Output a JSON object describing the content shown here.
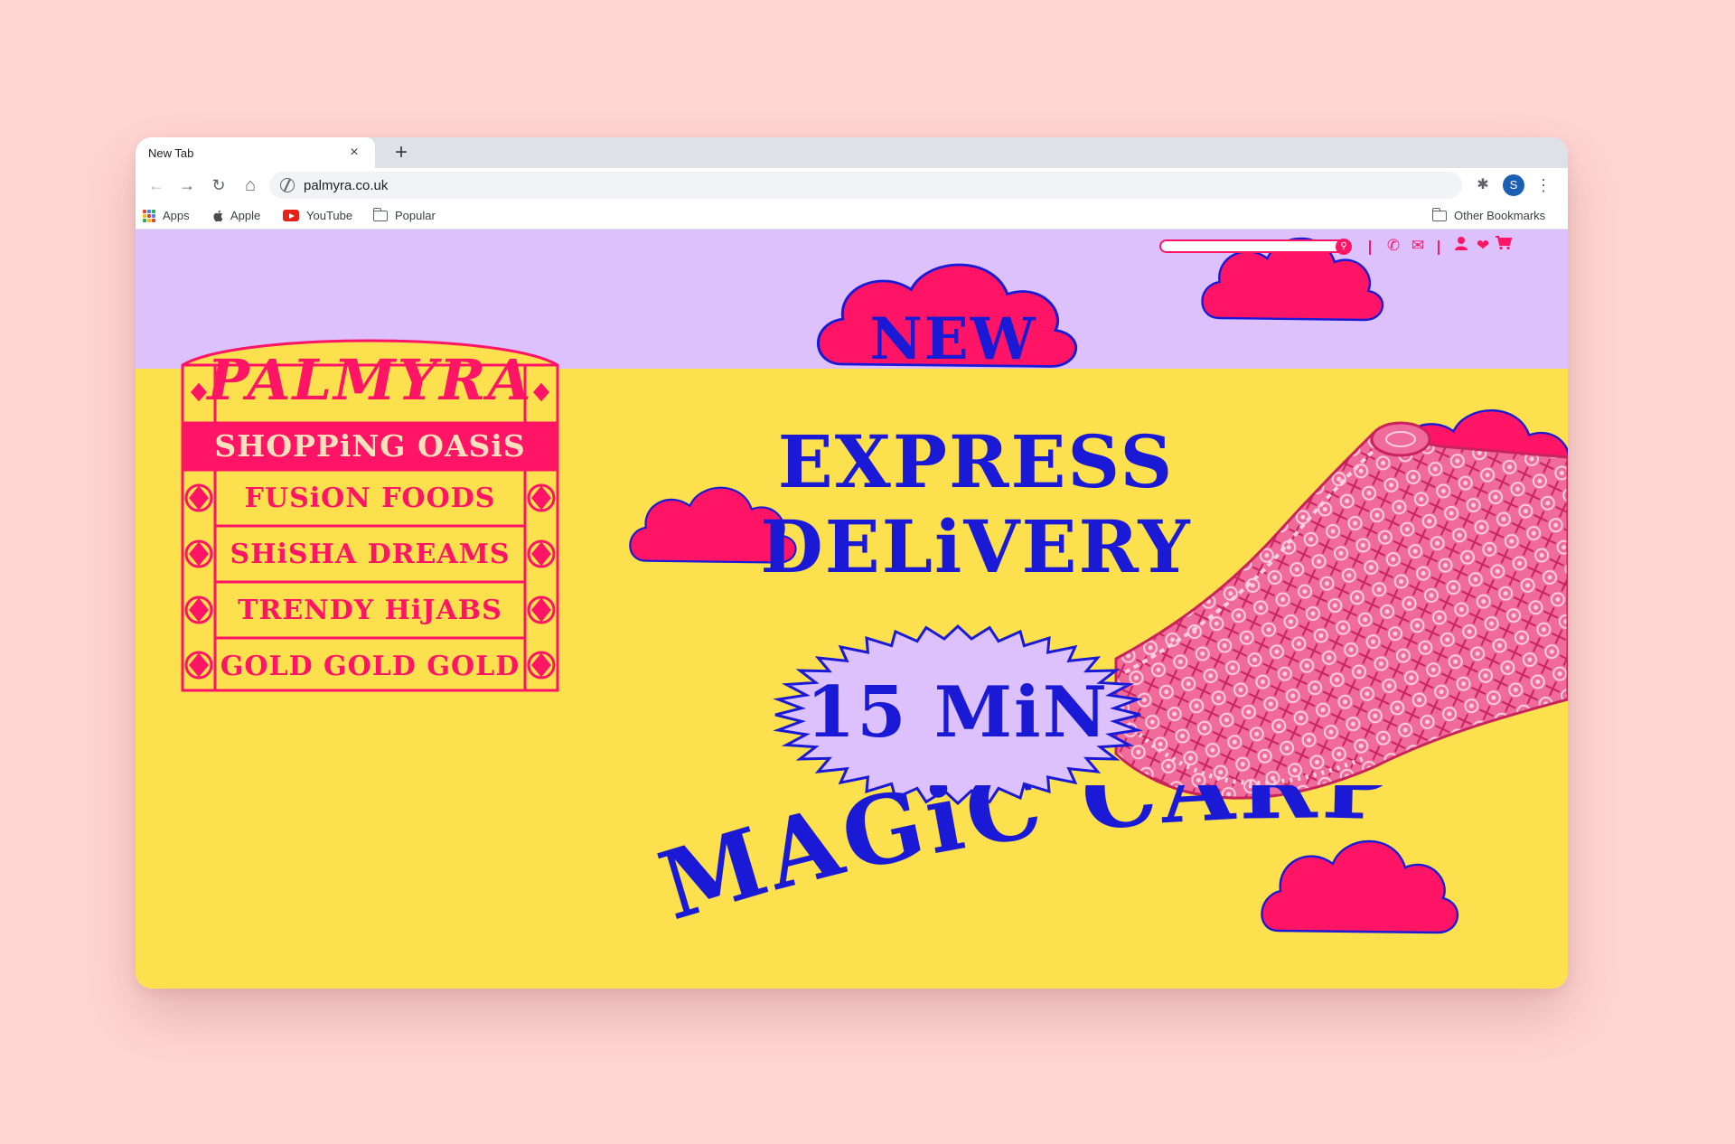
{
  "browser": {
    "tab_title": "New Tab",
    "tab_close": "×",
    "new_tab": "+",
    "url": "palmyra.co.uk",
    "profile_initial": "S",
    "back": "←",
    "forward": "→",
    "reload": "↻",
    "home": "⌂",
    "extensions": "✱",
    "menu": "⋮"
  },
  "bookmarks": {
    "items": [
      {
        "label": "Apps",
        "icon": "apps-grid-icon"
      },
      {
        "label": "Apple",
        "icon": "apple-icon"
      },
      {
        "label": "YouTube",
        "icon": "youtube-icon"
      },
      {
        "label": "Popular",
        "icon": "folder-icon"
      }
    ],
    "other": "Other Bookmarks"
  },
  "site": {
    "header_icons": [
      "search-icon",
      "phone-icon",
      "mail-icon",
      "user-icon",
      "heart-icon",
      "cart-icon"
    ],
    "board": {
      "brand": "PALMYRA",
      "tagline": "SHOPPiNG OASiS",
      "items": [
        "FUSiON FOODS",
        "SHiSHA DREAMS",
        "TRENDY HiJABS",
        "GOLD GOLD GOLD"
      ]
    },
    "hero": {
      "badge_top": "NEW",
      "line1": "EXPRESS",
      "line2": "DELiVERY",
      "time": "15 MiN",
      "tagline": "MAGiC CARPET"
    }
  },
  "colors": {
    "page_background": "#ffd6d4",
    "sky": "#dcc1fd",
    "ground": "#fce04e",
    "pink": "#ff1466",
    "blue": "#1a1ad6",
    "lilac": "#dcc1fd"
  }
}
